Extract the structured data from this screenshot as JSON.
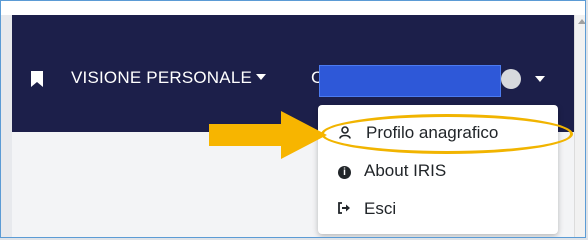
{
  "navbar": {
    "menu_label": "VISIONE PERSONALE",
    "user_initial": "C",
    "bookmark_icon": "bookmark-icon",
    "avatar_icon": "user-avatar-icon"
  },
  "dropdown": {
    "items": [
      {
        "label": "Profilo anagrafico",
        "icon": "user-icon"
      },
      {
        "label": "About IRIS",
        "icon": "info-circle-icon"
      },
      {
        "label": "Esci",
        "icon": "sign-out-icon"
      }
    ]
  },
  "colors": {
    "navbar_bg": "#1c1f4a",
    "annotation": "#f1b400",
    "redaction": "#2e58d8"
  }
}
